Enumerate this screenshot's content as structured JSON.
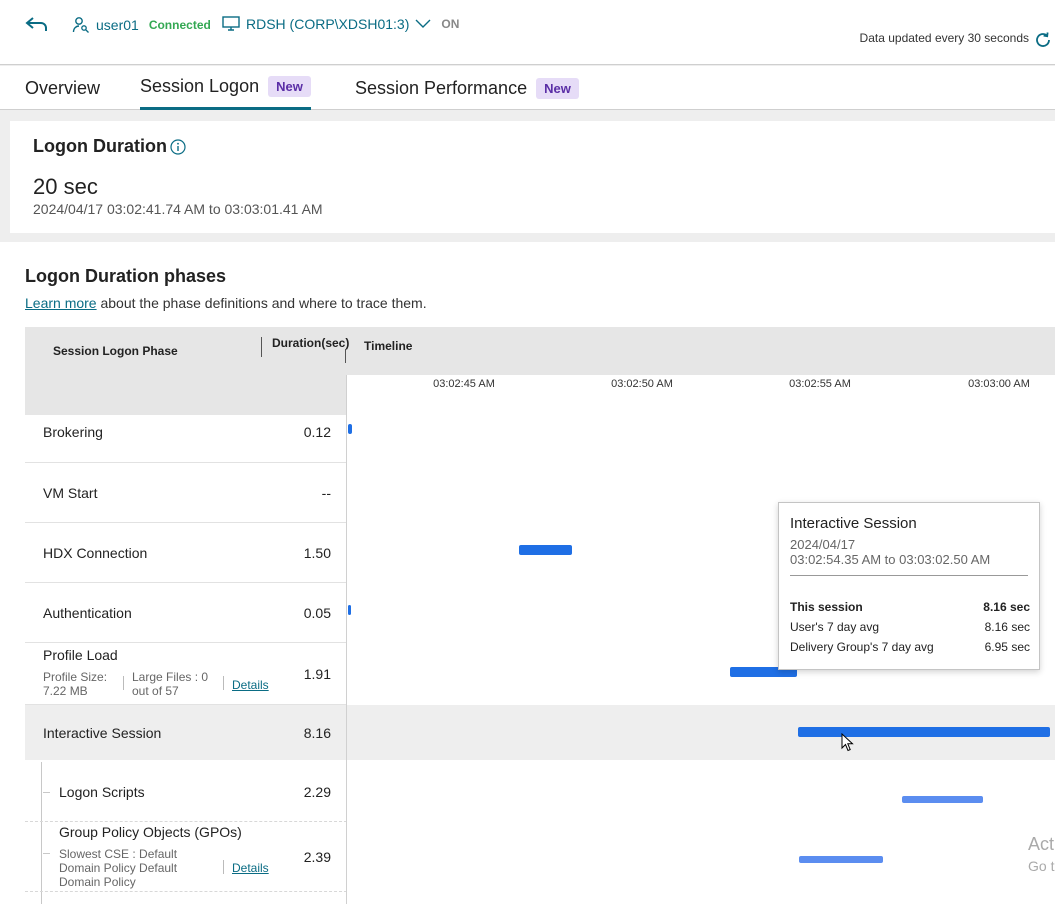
{
  "header": {
    "user": "user01",
    "status": "Connected",
    "host": "RDSH (CORP\\XDSH01:3)",
    "power": "ON",
    "updated": "Data updated every 30 seconds"
  },
  "tabs": [
    {
      "label": "Overview",
      "badge": ""
    },
    {
      "label": "Session Logon",
      "badge": "New"
    },
    {
      "label": "Session Performance",
      "badge": "New"
    }
  ],
  "summary": {
    "title": "Logon Duration",
    "duration": "20 sec",
    "range": "2024/04/17 03:02:41.74 AM to 03:03:01.41 AM"
  },
  "phases": {
    "title": "Logon Duration phases",
    "learn_more": "Learn more",
    "learn_more_rest": " about the phase definitions and where to trace them.",
    "col_phase": "Session Logon Phase",
    "col_duration": "Duration(sec)",
    "col_timeline": "Timeline",
    "ticks": [
      "03:02:45 AM",
      "03:02:50 AM",
      "03:02:55 AM",
      "03:03:00 AM"
    ],
    "rows": [
      {
        "name": "Brokering",
        "value": "0.12"
      },
      {
        "name": "VM Start",
        "value": "--"
      },
      {
        "name": "HDX Connection",
        "value": "1.50"
      },
      {
        "name": "Authentication",
        "value": "0.05"
      },
      {
        "name": "Profile Load",
        "value": "1.91",
        "profile_size_1": "Profile Size:",
        "profile_size_2": "7.22 MB",
        "large_files_1": "Large Files : 0",
        "large_files_2": "out of 57",
        "details": "Details"
      },
      {
        "name": "Interactive Session",
        "value": "8.16"
      },
      {
        "name": "Logon Scripts",
        "value": "2.29"
      },
      {
        "name": "Group Policy Objects (GPOs)",
        "value": "2.39",
        "cse_1": "Slowest CSE : Default",
        "cse_2": "Domain Policy Default",
        "cse_3": "Domain Policy",
        "details": "Details"
      }
    ]
  },
  "tooltip": {
    "title": "Interactive Session",
    "date": "2024/04/17",
    "range": "03:02:54.35 AM to 03:03:02.50 AM",
    "rows": [
      {
        "label": "This session",
        "value": "8.16 sec"
      },
      {
        "label": "User's 7 day avg",
        "value": "8.16 sec"
      },
      {
        "label": "Delivery Group's 7 day avg",
        "value": "6.95 sec"
      }
    ]
  },
  "watermark": {
    "line1": "Act",
    "line2": "Go t"
  },
  "colors": {
    "accent": "#0a6c84",
    "bar": "#1f6fe5",
    "bar_light": "#5b8df0",
    "connected": "#34a853",
    "badge_bg": "#e6dcf7",
    "badge_fg": "#5a2ea6"
  }
}
